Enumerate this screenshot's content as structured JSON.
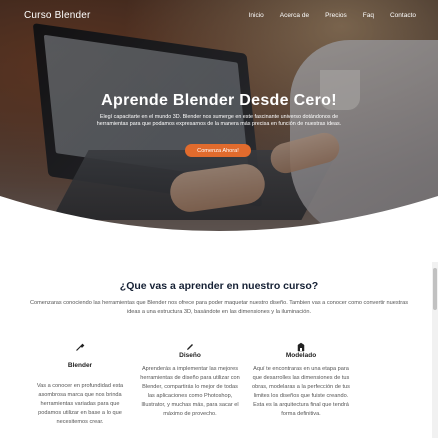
{
  "navbar": {
    "brand": "Curso Blender",
    "links": [
      "Inicio",
      "Acerca de",
      "Precios",
      "Faq",
      "Contacto"
    ]
  },
  "hero": {
    "title": "Aprende Blender Desde Cero!",
    "subtitle": "Elegí capacitarte en el mundo 3D. Blender nos sumerge en este fascinante universo dotándonos de herramientas para que podamos expresarnos de la manera más precisa en función de nuestras ideas.",
    "cta_label": "Comenza Ahora!"
  },
  "intro": {
    "title": "¿Que vas a aprender en nuestro curso?",
    "description": "Comenzaras conociendo las herramientas que Blender nos ofrece para poder maquetar nuestro diseño. Tambien vas a conocer como convertir nuestras ideas a una estructura 3D, basándote en las dimensiones y la iluminación."
  },
  "features": [
    {
      "icon": "wrench-icon",
      "title": "Blender",
      "text": "Vas a conocer en profundidad esta asombrosa marca que nos brinda herramientas variadas para que podamos utilizar en base a lo que necesitemos crear."
    },
    {
      "icon": "pencil-icon",
      "title": "Diseño",
      "text": "Aprenderás a implementar las mejores herramientas de diseño para utilizar con Blender, compartirás lo mejor de todas las aplicaciones como Photoshop, Illustrator, y muchas más, para sacar el máximo de provecho."
    },
    {
      "icon": "building-icon",
      "title": "Modelado",
      "text": "Aquí te encontraras en una etapa para que desarrolles las dimensiones de tus obras, modelaras a la perfección de tus limites los diseños que fuiste creando. Esta es la arquitectura final que tendrá forma definitiva."
    }
  ],
  "colors": {
    "accent": "#e16b2d",
    "heading": "#152034"
  }
}
